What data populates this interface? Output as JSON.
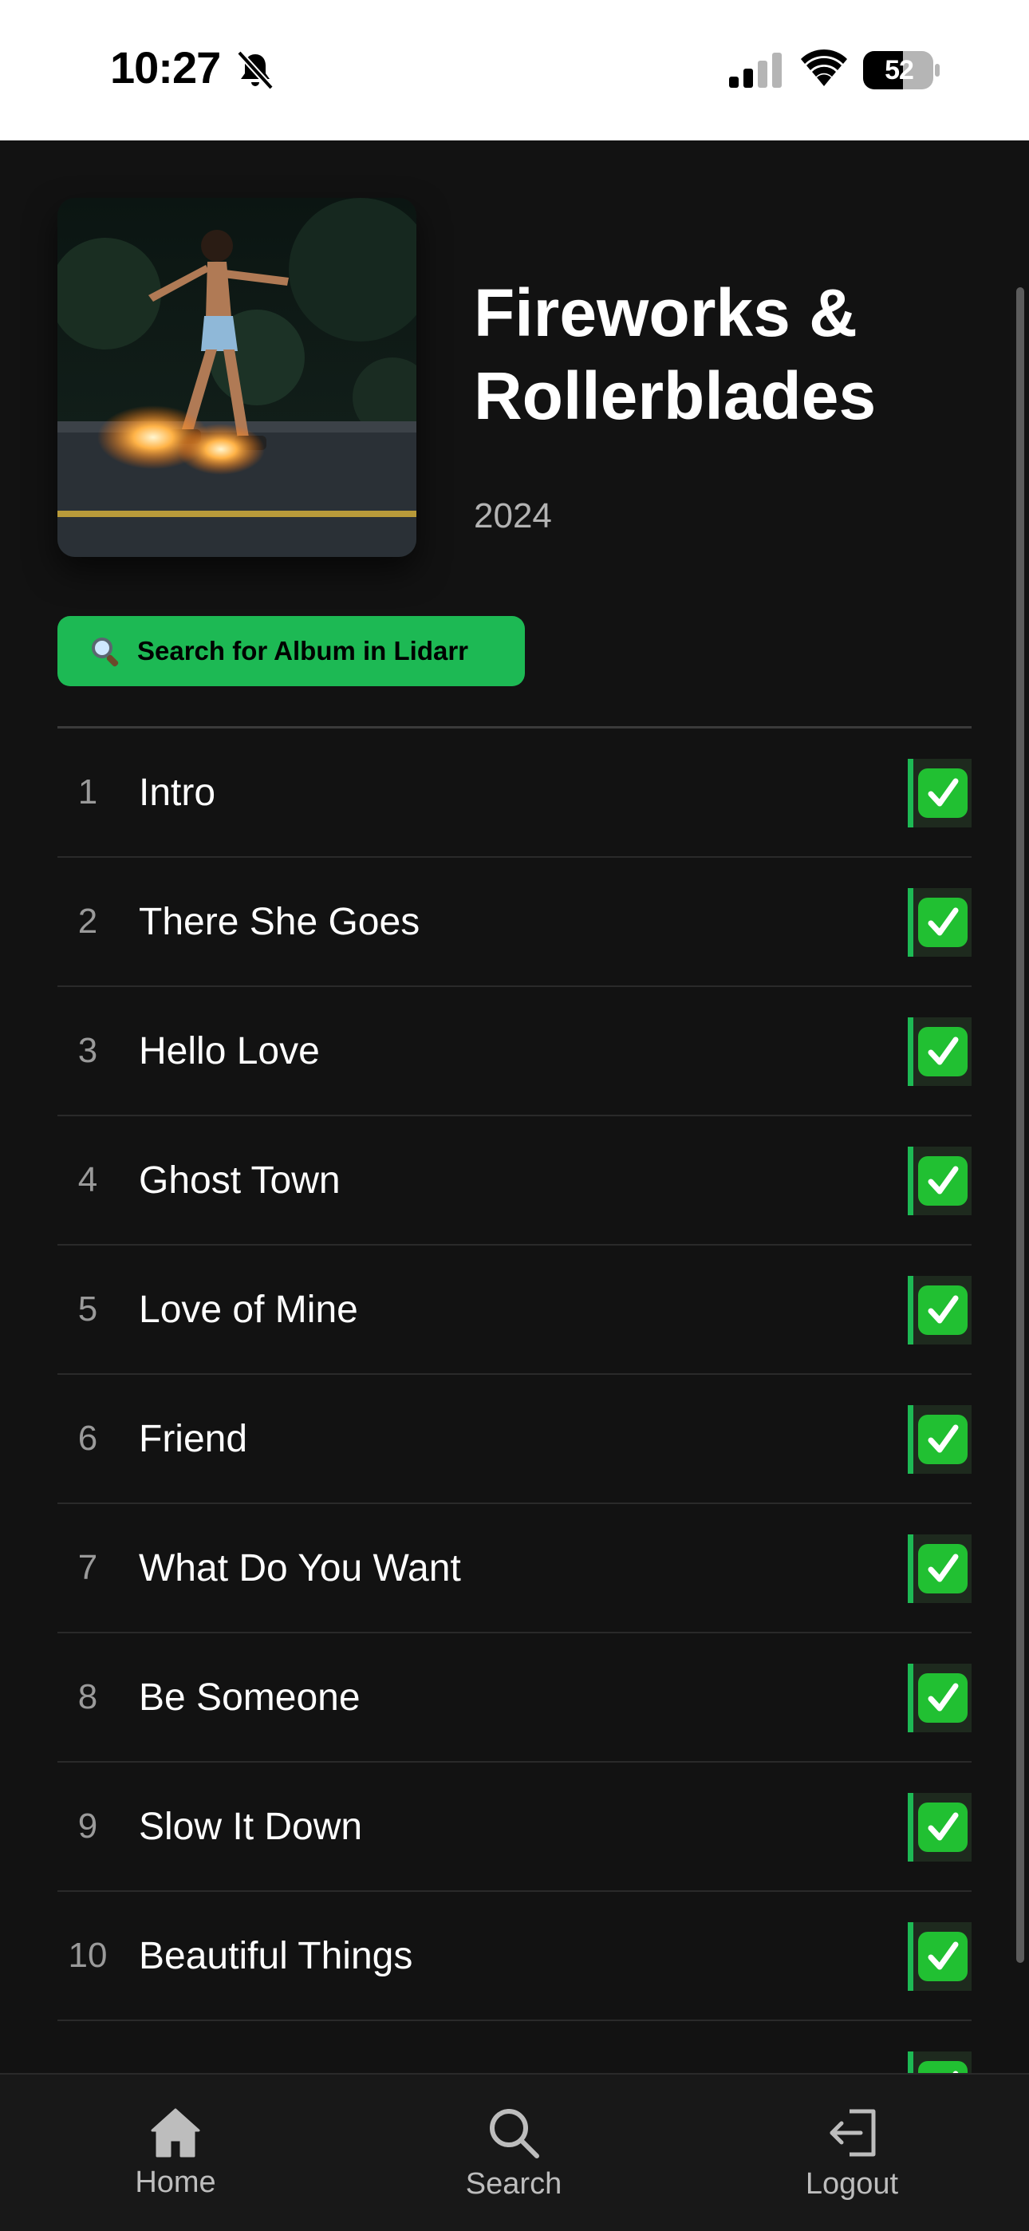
{
  "status_bar": {
    "time": "10:27",
    "battery": "52"
  },
  "album": {
    "title": "Fireworks & Rollerblades",
    "year": "2024"
  },
  "search_button": {
    "label": "Search for Album in Lidarr"
  },
  "tracks": [
    {
      "number": "1",
      "title": "Intro",
      "downloaded": true
    },
    {
      "number": "2",
      "title": "There She Goes",
      "downloaded": true
    },
    {
      "number": "3",
      "title": "Hello Love",
      "downloaded": true
    },
    {
      "number": "4",
      "title": "Ghost Town",
      "downloaded": true
    },
    {
      "number": "5",
      "title": "Love of Mine",
      "downloaded": true
    },
    {
      "number": "6",
      "title": "Friend",
      "downloaded": true
    },
    {
      "number": "7",
      "title": "What Do You Want",
      "downloaded": true
    },
    {
      "number": "8",
      "title": "Be Someone",
      "downloaded": true
    },
    {
      "number": "9",
      "title": "Slow It Down",
      "downloaded": true
    },
    {
      "number": "10",
      "title": "Beautiful Things",
      "downloaded": true
    }
  ],
  "nav": {
    "home": "Home",
    "search": "Search",
    "logout": "Logout"
  },
  "colors": {
    "accent": "#1db954",
    "background": "#121212",
    "check": "#21c032"
  }
}
